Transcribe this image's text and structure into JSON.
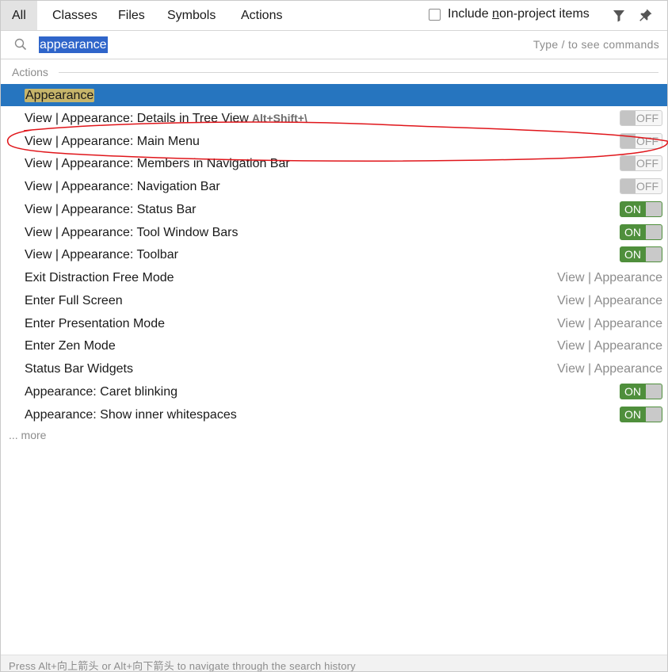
{
  "tabs": [
    {
      "label": "All",
      "active": true
    },
    {
      "label": "Classes",
      "active": false
    },
    {
      "label": "Files",
      "active": false
    },
    {
      "label": "Symbols",
      "active": false
    },
    {
      "label": "Actions",
      "active": false
    }
  ],
  "include_non_project": {
    "label_pre": "Include ",
    "label_underlined": "n",
    "label_post": "on-project items",
    "checked": false
  },
  "icons": {
    "filter": "filter-icon",
    "pin": "pin-icon",
    "search": "search-icon"
  },
  "search": {
    "value": "appearance",
    "hint": "Type / to see commands"
  },
  "section_title": "Actions",
  "rows": [
    {
      "label": "Appearance",
      "selected": true,
      "right_type": "none"
    },
    {
      "label": "View | Appearance: Details in Tree View",
      "shortcut": "Alt+Shift+\\",
      "right_type": "toggle",
      "toggle": "OFF"
    },
    {
      "label": "View | Appearance: Main Menu",
      "right_type": "toggle",
      "toggle": "OFF"
    },
    {
      "label": "View | Appearance: Members in Navigation Bar",
      "right_type": "toggle",
      "toggle": "OFF"
    },
    {
      "label": "View | Appearance: Navigation Bar",
      "right_type": "toggle",
      "toggle": "OFF"
    },
    {
      "label": "View | Appearance: Status Bar",
      "right_type": "toggle",
      "toggle": "ON"
    },
    {
      "label": "View | Appearance: Tool Window Bars",
      "right_type": "toggle",
      "toggle": "ON"
    },
    {
      "label": "View | Appearance: Toolbar",
      "right_type": "toggle",
      "toggle": "ON"
    },
    {
      "label": "Exit Distraction Free Mode",
      "right_type": "text",
      "right_text": "View | Appearance"
    },
    {
      "label": "Enter Full Screen",
      "right_type": "text",
      "right_text": "View | Appearance"
    },
    {
      "label": "Enter Presentation Mode",
      "right_type": "text",
      "right_text": "View | Appearance"
    },
    {
      "label": "Enter Zen Mode",
      "right_type": "text",
      "right_text": "View | Appearance"
    },
    {
      "label": "Status Bar Widgets",
      "right_type": "text",
      "right_text": "View | Appearance"
    },
    {
      "label": "Appearance: Caret blinking",
      "right_type": "toggle",
      "toggle": "ON"
    },
    {
      "label": "Appearance: Show inner whitespaces",
      "right_type": "toggle",
      "toggle": "ON"
    }
  ],
  "more_label": "... more",
  "status_text": "Press Alt+向上箭头 or Alt+向下箭头 to navigate through the search history",
  "colors": {
    "selection": "#2675bf",
    "highlight": "#c7b56a",
    "toggle_on": "#4f8f3c",
    "annotation": "#e0161b"
  }
}
